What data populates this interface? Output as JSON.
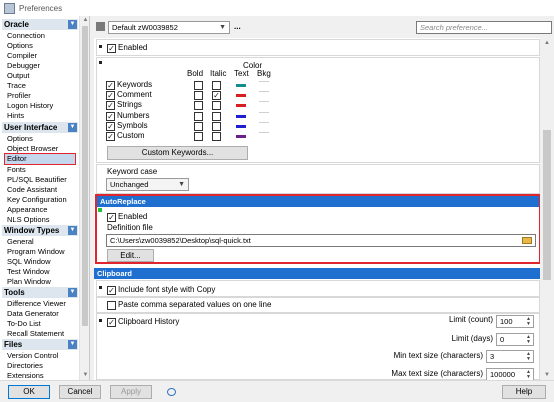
{
  "window": {
    "title": "Preferences"
  },
  "toolbar": {
    "profile_value": "Default zW0039852",
    "more_label": "...",
    "search_placeholder": "Search preference..."
  },
  "sidebar": {
    "groups": [
      {
        "label": "Oracle",
        "items": [
          "Connection",
          "Options",
          "Compiler",
          "Debugger",
          "Output",
          "Trace",
          "Profiler",
          "Logon History",
          "Hints"
        ]
      },
      {
        "label": "User Interface",
        "items": [
          "Options",
          "Object Browser",
          "Editor",
          "Fonts",
          "PL/SQL Beautifier",
          "Code Assistant",
          "Key Configuration",
          "Appearance",
          "NLS Options"
        ]
      },
      {
        "label": "Window Types",
        "items": [
          "General",
          "Program Window",
          "SQL Window",
          "Test Window",
          "Plan Window"
        ]
      },
      {
        "label": "Tools",
        "items": [
          "Difference Viewer",
          "Data Generator",
          "To-Do List",
          "Recall Statement"
        ]
      },
      {
        "label": "Files",
        "items": [
          "Version Control",
          "Directories",
          "Extensions"
        ]
      }
    ],
    "selected": "Editor"
  },
  "syntax": {
    "enabled_label": "Enabled",
    "col_bold": "Bold",
    "col_italic": "Italic",
    "col_color_top": "Color",
    "col_text": "Text",
    "col_bkg": "Bkg",
    "rows": [
      {
        "label": "Keywords",
        "bold": false,
        "italic": false,
        "color": "#138d8d"
      },
      {
        "label": "Comment",
        "bold": false,
        "italic": true,
        "color": "#d81e1e"
      },
      {
        "label": "Strings",
        "bold": false,
        "italic": false,
        "color": "#d81e1e"
      },
      {
        "label": "Numbers",
        "bold": false,
        "italic": false,
        "color": "#1f1fcf"
      },
      {
        "label": "Symbols",
        "bold": false,
        "italic": false,
        "color": "#1f1fcf"
      },
      {
        "label": "Custom",
        "bold": false,
        "italic": false,
        "color": "#6a1f8a"
      }
    ],
    "custom_keywords_label": "Custom Keywords..."
  },
  "keyword_case": {
    "label": "Keyword case",
    "value": "Unchanged"
  },
  "autoreplace": {
    "header": "AutoReplace",
    "enabled_label": "Enabled",
    "definition_label": "Definition file",
    "definition_value": "C:\\Users\\zw0039852\\Desktop\\sql-quick.txt",
    "edit_label": "Edit..."
  },
  "clipboard": {
    "header": "Clipboard",
    "include_font_label": "Include font style with Copy",
    "paste_comma_label": "Paste comma separated values on one line",
    "history_label": "Clipboard History",
    "limit_count_label": "Limit (count)",
    "limit_count_value": "100",
    "limit_days_label": "Limit (days)",
    "limit_days_value": "0",
    "min_text_label": "Min text size (characters)",
    "min_text_value": "3",
    "max_text_label": "Max text size (characters)",
    "max_text_value": "100000"
  },
  "footer": {
    "ok": "OK",
    "cancel": "Cancel",
    "apply": "Apply",
    "help": "Help"
  }
}
